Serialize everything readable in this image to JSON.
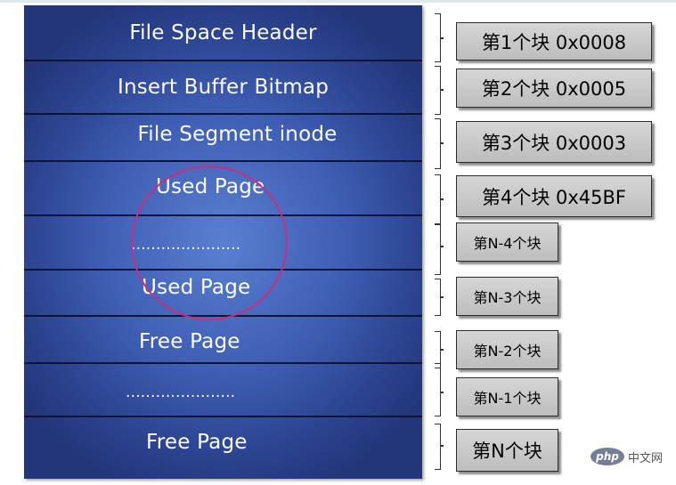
{
  "pages": [
    "File Space Header",
    "Insert Buffer Bitmap",
    "File Segment inode",
    "Used Page",
    "......................",
    "Used Page",
    "Free Page",
    "......................",
    "Free Page"
  ],
  "blocks": [
    "第1个块 0x0008",
    "第2个块 0x0005",
    "第3个块 0x0003",
    "第4个块 0x45BF",
    "第N-4个块",
    "第N-3个块",
    "第N-2个块",
    "第N-1个块",
    "第N个块"
  ],
  "watermark": {
    "logo": "php",
    "text": "中文网"
  },
  "colors": {
    "ring": "#c4307f",
    "stack": "#2b428e",
    "box": "#c8c8c8"
  }
}
